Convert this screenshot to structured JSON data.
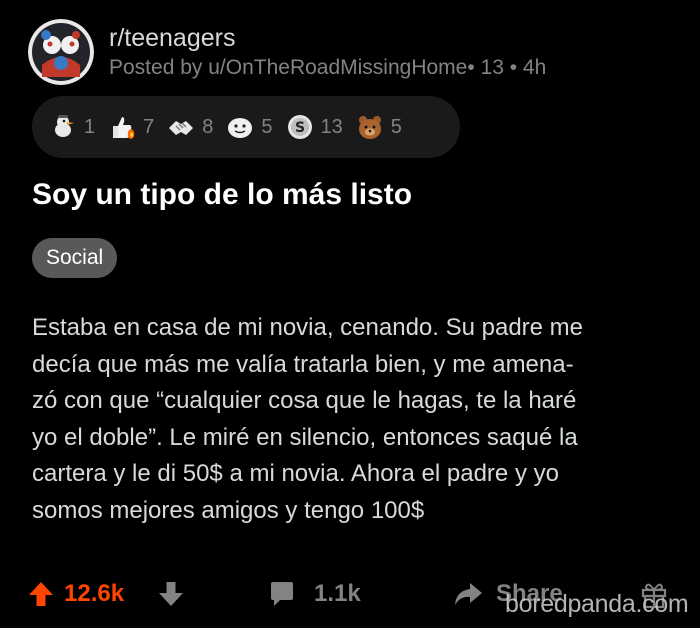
{
  "post": {
    "subreddit": "r/teenagers",
    "posted_by": "Posted by u/OnTheRoadMissingHome• 13 • 4h",
    "title": "Soy un tipo de lo más listo",
    "flair": "Social",
    "body_lines": [
      "Estaba en casa de mi novia, cenando. Su padre me",
      "decía que más me valía tratarla bien, y me amena-",
      "zó con que “cualquier cosa que le hagas, te la haré",
      "yo el doble”. Le miré en silencio, entonces saqué la",
      "cartera y le di 50$ a mi novia. Ahora el padre y yo",
      "somos mejores amigos y tengo 100$"
    ]
  },
  "awards": [
    {
      "icon": "duck-award-icon",
      "count": "1"
    },
    {
      "icon": "thumbs-up-fire-award-icon",
      "count": "7"
    },
    {
      "icon": "handshake-award-icon",
      "count": "8"
    },
    {
      "icon": "face-award-icon",
      "count": "5"
    },
    {
      "icon": "silver-coin-award-icon",
      "count": "13"
    },
    {
      "icon": "bear-award-icon",
      "count": "5"
    }
  ],
  "actions": {
    "score": "12.6k",
    "comments": "1.1k",
    "share": "Share"
  },
  "watermark": "boredpanda.com",
  "colors": {
    "background": "#000000",
    "upvote": "#ff4500",
    "muted": "#818384",
    "flair_bg": "#58595a",
    "award_bar_bg": "#1a1a1b"
  }
}
